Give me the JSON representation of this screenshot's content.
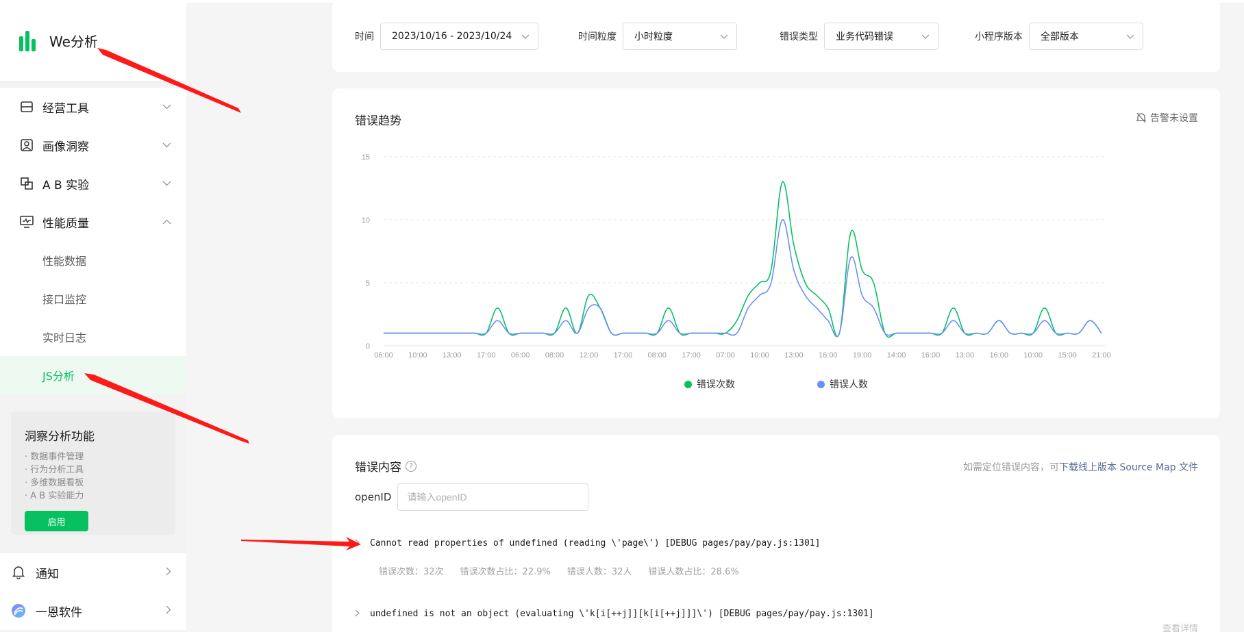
{
  "sidebar": {
    "brand": "We分析",
    "menu": [
      {
        "label": "经营工具",
        "icon": "tray-icon",
        "expanded": false
      },
      {
        "label": "画像洞察",
        "icon": "portrait-icon",
        "expanded": false
      },
      {
        "label": "A B 实验",
        "icon": "ab-experiment-icon",
        "expanded": false
      },
      {
        "label": "性能质量",
        "icon": "monitor-icon",
        "expanded": true
      }
    ],
    "submenu": [
      {
        "label": "性能数据"
      },
      {
        "label": "接口监控"
      },
      {
        "label": "实时日志"
      },
      {
        "label": "JS分析"
      }
    ],
    "active_submenu": "JS分析",
    "insight": {
      "title": "洞察分析功能",
      "features": [
        "· 数据事件管理",
        "· 行为分析工具",
        "· 多维数据看板",
        "· A B 实验能力"
      ],
      "button": "启用"
    },
    "bottom": [
      {
        "label": "通知",
        "icon": "bell-icon"
      },
      {
        "label": "一恩软件",
        "icon": "account-avatar-icon"
      }
    ]
  },
  "filters": {
    "time": {
      "label": "时间",
      "value": "2023/10/16 - 2023/10/24"
    },
    "granularity": {
      "label": "时间粒度",
      "value": "小时粒度"
    },
    "error_type": {
      "label": "错误类型",
      "value": "业务代码错误"
    },
    "version": {
      "label": "小程序版本",
      "value": "全部版本"
    }
  },
  "trend": {
    "title": "错误趋势",
    "alarm": "告警未设置"
  },
  "chart_data": {
    "type": "line",
    "title": "错误趋势",
    "xlabel": "",
    "ylabel": "",
    "ylim": [
      0,
      15
    ],
    "y_ticks": [
      0,
      5,
      10,
      15
    ],
    "x_tick_labels": [
      "06:00",
      "10:00",
      "13:00",
      "17:00",
      "06:00",
      "08:00",
      "12:00",
      "17:00",
      "08:00",
      "17:00",
      "07:00",
      "10:00",
      "13:00",
      "16:00",
      "19:00",
      "14:00",
      "16:00",
      "13:00",
      "16:00",
      "10:00",
      "15:00",
      "21:00"
    ],
    "grid": true,
    "legend_position": "bottom",
    "x": [
      0,
      1,
      2,
      3,
      4,
      5,
      6,
      7,
      8,
      9,
      10,
      11,
      12,
      13,
      14,
      15,
      16,
      17,
      18,
      19,
      20,
      21,
      22,
      23,
      24,
      25,
      26,
      27,
      28,
      29,
      30,
      31,
      32,
      33,
      34,
      35,
      36,
      37,
      38,
      39,
      40,
      41,
      42,
      43,
      44,
      45,
      46,
      47,
      48,
      49,
      50,
      51,
      52,
      53,
      54,
      55,
      56,
      57,
      58,
      59,
      60,
      61,
      62,
      63
    ],
    "series": [
      {
        "name": "错误次数",
        "color": "#07c160",
        "values": [
          1,
          1,
          1,
          1,
          1,
          1,
          1,
          1,
          1,
          1,
          3,
          1,
          1,
          1,
          1,
          1,
          3,
          1,
          4,
          3,
          1,
          1,
          1,
          1,
          1,
          3,
          1,
          1,
          1,
          1,
          1,
          2,
          4,
          5,
          6,
          13,
          8,
          5,
          4,
          3,
          1,
          9,
          6,
          5,
          1,
          1,
          1,
          1,
          1,
          1,
          3,
          1,
          1,
          1,
          2,
          1,
          1,
          1,
          3,
          1,
          1,
          1,
          2,
          1
        ]
      },
      {
        "name": "错误人数",
        "color": "#6a8ff7",
        "values": [
          1,
          1,
          1,
          1,
          1,
          1,
          1,
          1,
          1,
          1,
          2,
          1,
          1,
          1,
          1,
          1,
          2,
          1,
          3,
          3,
          1,
          1,
          1,
          1,
          1,
          2,
          1,
          1,
          1,
          1,
          1,
          1,
          3,
          4,
          5,
          10,
          6,
          4,
          3,
          2,
          1,
          7,
          4,
          3,
          1,
          1,
          1,
          1,
          1,
          1,
          2,
          1,
          1,
          1,
          2,
          1,
          1,
          1,
          2,
          1,
          1,
          1,
          2,
          1
        ]
      }
    ]
  },
  "errors": {
    "title": "错误内容",
    "help": "?",
    "hint_prefix": "如需定位错误内容，可",
    "hint_link": "下载线上版本 Source Map 文件",
    "openid_label": "openID",
    "openid_placeholder": "请输入openID",
    "items": [
      {
        "message": "Cannot read properties of undefined (reading \\'page\\') [DEBUG pages/pay/pay.js:1301]",
        "stats": [
          "错误次数：32次",
          "错误次数占比：22.9%",
          "错误人数：32人",
          "错误人数占比：28.6%"
        ],
        "expanded": true
      },
      {
        "message": "undefined is not an object (evaluating \\'k[i[++j]][k[i[++j]]]\\') [DEBUG pages/pay/pay.js:1301]",
        "detail": "查看详情",
        "expanded": false
      }
    ]
  }
}
